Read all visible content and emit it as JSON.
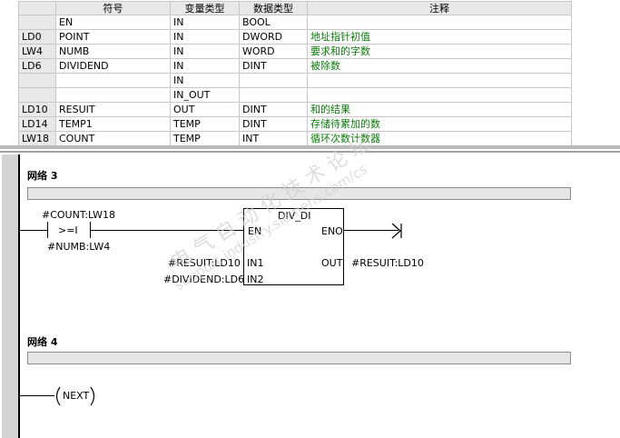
{
  "table": {
    "headers": [
      "符号",
      "变量类型",
      "数据类型",
      "注释"
    ],
    "rows": [
      {
        "addr": "",
        "symbol": "EN",
        "var_type": "IN",
        "data_type": "BOOL",
        "comment": ""
      },
      {
        "addr": "LD0",
        "symbol": "POINT",
        "var_type": "IN",
        "data_type": "DWORD",
        "comment": "地址指针初值"
      },
      {
        "addr": "LW4",
        "symbol": "NUMB",
        "var_type": "IN",
        "data_type": "WORD",
        "comment": "要求和的字数"
      },
      {
        "addr": "LD6",
        "symbol": "DIVIDEND",
        "var_type": "IN",
        "data_type": "DINT",
        "comment": "被除数"
      },
      {
        "addr": "",
        "symbol": "",
        "var_type": "IN",
        "data_type": "",
        "comment": ""
      },
      {
        "addr": "",
        "symbol": "",
        "var_type": "IN_OUT",
        "data_type": "",
        "comment": ""
      },
      {
        "addr": "LD10",
        "symbol": "RESUIT",
        "var_type": "OUT",
        "data_type": "DINT",
        "comment": "和的结果"
      },
      {
        "addr": "LD14",
        "symbol": "TEMP1",
        "var_type": "TEMP",
        "data_type": "DINT",
        "comment": "存储待累加的数"
      },
      {
        "addr": "LW18",
        "symbol": "COUNT",
        "var_type": "TEMP",
        "data_type": "INT",
        "comment": "循环次数计数器"
      }
    ]
  },
  "network3": {
    "title": "网络 3",
    "contact_top": "#COUNT:LW18",
    "contact_op": ">=I",
    "contact_bottom": "#NUMB:LW4",
    "box_title": "DIV_DI",
    "pin_en": "EN",
    "pin_eno": "ENO",
    "pin_in1": "IN1",
    "pin_in2": "IN2",
    "pin_out": "OUT",
    "in1_operand": "#RESUIT:LD10",
    "in2_operand": "#DIVIDEND:LD6",
    "out_operand": "#RESUIT:LD10"
  },
  "network4": {
    "title": "网络 4",
    "coil": "NEXT"
  },
  "watermark": {
    "line1": "电 气 自 动 化 技 术 论 坛",
    "line2": "support.industry.siemens.com/cs"
  }
}
